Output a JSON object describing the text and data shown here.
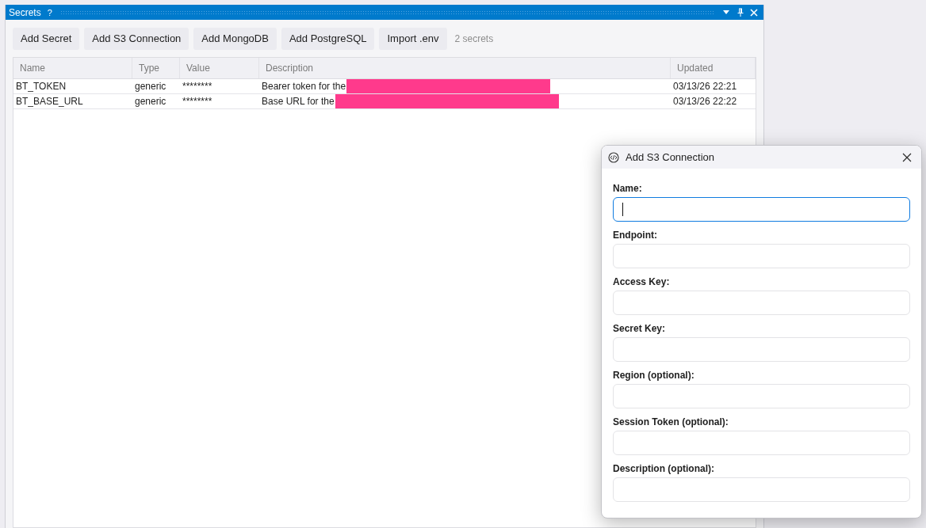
{
  "panel": {
    "title": "Secrets",
    "help_label": "?"
  },
  "toolbar": {
    "buttons": [
      "Add Secret",
      "Add S3 Connection",
      "Add MongoDB",
      "Add PostgreSQL",
      "Import .env"
    ],
    "count": "2 secrets"
  },
  "table": {
    "columns": [
      "Name",
      "Type",
      "Value",
      "Description",
      "Updated"
    ],
    "rows": [
      {
        "name": "BT_TOKEN",
        "type": "generic",
        "value": "********",
        "description": "Bearer token for the",
        "redacted": true,
        "updated": "03/13/26 22:21"
      },
      {
        "name": "BT_BASE_URL",
        "type": "generic",
        "value": "********",
        "description": "Base URL for the",
        "redacted": true,
        "updated": "03/13/26 22:22"
      }
    ]
  },
  "dialog": {
    "title": "Add S3 Connection",
    "fields": [
      {
        "label": "Name:",
        "focused": true
      },
      {
        "label": "Endpoint:",
        "focused": false
      },
      {
        "label": "Access Key:",
        "focused": false
      },
      {
        "label": "Secret Key:",
        "focused": false
      },
      {
        "label": "Region (optional):",
        "focused": false
      },
      {
        "label": "Session Token (optional):",
        "focused": false
      },
      {
        "label": "Description (optional):",
        "focused": false
      }
    ]
  }
}
